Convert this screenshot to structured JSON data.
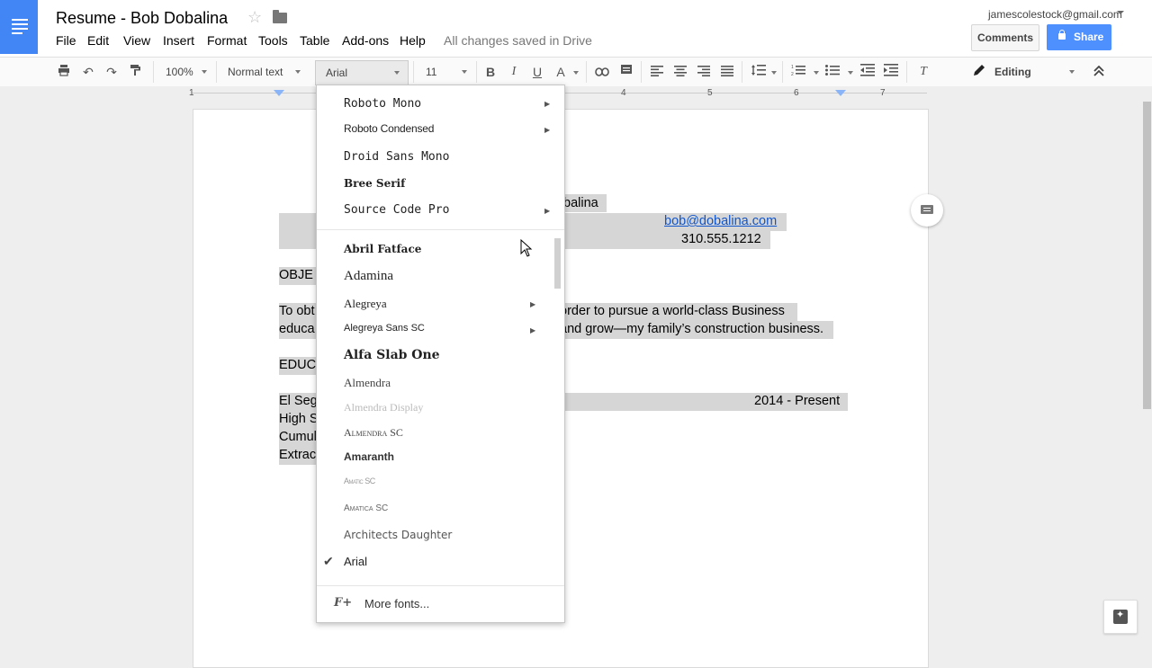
{
  "header": {
    "title": "Resume - Bob Dobalina",
    "menus": [
      "File",
      "Edit",
      "View",
      "Insert",
      "Format",
      "Tools",
      "Table",
      "Add-ons",
      "Help"
    ],
    "save_status": "All changes saved in Drive",
    "account": "jamescolestock@gmail.com",
    "comments_label": "Comments",
    "share_label": "Share"
  },
  "toolbar": {
    "zoom": "100%",
    "style": "Normal text",
    "font": "Arial",
    "size": "11",
    "mode": "Editing",
    "icons": [
      "print-icon",
      "undo-icon",
      "redo-icon",
      "paint-format-icon",
      "bold-icon",
      "italic-icon",
      "underline-icon",
      "text-color-icon",
      "link-icon",
      "comment-icon",
      "align-left-icon",
      "align-center-icon",
      "align-right-icon",
      "justify-icon",
      "line-spacing-icon",
      "numbered-list-icon",
      "bulleted-list-icon",
      "decrease-indent-icon",
      "increase-indent-icon",
      "clear-formatting-icon",
      "pencil-icon",
      "collapse-icon"
    ],
    "bold_glyph": "B",
    "italic_glyph": "I",
    "underline_glyph": "U",
    "textcolor_glyph": "A",
    "clear_glyph": "T"
  },
  "ruler": {
    "numbers": [
      "1",
      "4",
      "5",
      "6",
      "7"
    ]
  },
  "document": {
    "name_partial": "balina",
    "email": "bob@dobalina.com",
    "phone": "310.555.1212",
    "objective_heading_partial": "OBJE",
    "objective_line1_left": "To obt",
    "objective_line1_right": "order to pursue a world-class Business",
    "objective_line2_left": "educa",
    "objective_line2_right": "and grow—my family’s construction business.",
    "education_heading_partial": "EDUC",
    "school_partial": "El Seg",
    "dates": "2014 - Present",
    "line_high": "High S",
    "line_cumul": "Cumul",
    "line_extra": "Extrac"
  },
  "font_menu": {
    "recent": [
      {
        "label": "Roboto Mono",
        "submenu": true
      },
      {
        "label": "Roboto Condensed",
        "submenu": true
      },
      {
        "label": "Droid Sans Mono",
        "submenu": false
      },
      {
        "label": "Bree Serif",
        "submenu": false
      },
      {
        "label": "Source Code Pro",
        "submenu": true
      }
    ],
    "all": [
      {
        "label": "Abril Fatface",
        "submenu": false
      },
      {
        "label": "Adamina",
        "submenu": false
      },
      {
        "label": "Alegreya",
        "submenu": true
      },
      {
        "label": "Alegreya Sans SC",
        "submenu": true
      },
      {
        "label": "Alfa Slab One",
        "submenu": false
      },
      {
        "label": "Almendra",
        "submenu": false
      },
      {
        "label": "Almendra Display",
        "submenu": false
      },
      {
        "label": "Almendra SC",
        "submenu": false
      },
      {
        "label": "Amaranth",
        "submenu": false
      },
      {
        "label": "Amatic SC",
        "submenu": false
      },
      {
        "label": "Amatica SC",
        "submenu": false
      },
      {
        "label": "Architects Daughter",
        "submenu": false
      },
      {
        "label": "Arial",
        "submenu": false,
        "selected": true
      }
    ],
    "more_fonts_label": "More fonts...",
    "more_fonts_glyph": "F+",
    "check_glyph": "✔",
    "arrow_glyph": "▶"
  }
}
